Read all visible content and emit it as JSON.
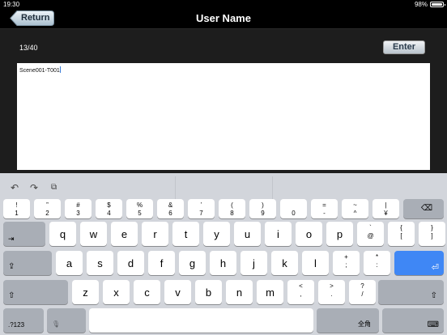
{
  "status": {
    "time": "19:30",
    "battery": "98%",
    "battery_level": 0.98
  },
  "nav": {
    "title": "User Name",
    "return_label": "Return"
  },
  "content": {
    "counter": "13/40",
    "enter_label": "Enter",
    "input_value": "Scene001-T001"
  },
  "keyboard": {
    "toolbar": [
      {
        "icon": "undo-icon"
      },
      {
        "icon": "redo-icon"
      },
      {
        "icon": "paste-icon"
      }
    ],
    "row1": [
      {
        "t": "!",
        "b": "1"
      },
      {
        "t": "”",
        "b": "2"
      },
      {
        "t": "#",
        "b": "3"
      },
      {
        "t": "$",
        "b": "4"
      },
      {
        "t": "%",
        "b": "5"
      },
      {
        "t": "&",
        "b": "6"
      },
      {
        "t": "’",
        "b": "7"
      },
      {
        "t": "(",
        "b": "8"
      },
      {
        "t": ")",
        "b": "9"
      },
      {
        "t": "",
        "b": "0"
      },
      {
        "t": "=",
        "b": "-"
      },
      {
        "t": "~",
        "b": "^"
      },
      {
        "t": "|",
        "b": "¥"
      }
    ],
    "row2": [
      {
        "k": "q"
      },
      {
        "k": "w"
      },
      {
        "k": "e"
      },
      {
        "k": "r"
      },
      {
        "k": "t"
      },
      {
        "k": "y"
      },
      {
        "k": "u"
      },
      {
        "k": "i"
      },
      {
        "k": "o"
      },
      {
        "k": "p"
      },
      {
        "t": "`",
        "b": "@"
      },
      {
        "t": "{",
        "b": "["
      },
      {
        "t": "}",
        "b": "]"
      }
    ],
    "row3": [
      {
        "k": "a"
      },
      {
        "k": "s"
      },
      {
        "k": "d"
      },
      {
        "k": "f"
      },
      {
        "k": "g"
      },
      {
        "k": "h"
      },
      {
        "k": "j"
      },
      {
        "k": "k"
      },
      {
        "k": "l"
      },
      {
        "t": "+",
        "b": ";"
      },
      {
        "t": "*",
        "b": ":"
      }
    ],
    "row4": [
      {
        "k": "z"
      },
      {
        "k": "x"
      },
      {
        "k": "c"
      },
      {
        "k": "v"
      },
      {
        "k": "b"
      },
      {
        "k": "n"
      },
      {
        "k": "m"
      },
      {
        "t": "<",
        "b": ","
      },
      {
        "t": ">",
        "b": "."
      },
      {
        "t": "?",
        "b": "/"
      }
    ],
    "numbers_label": ".?123",
    "kana_label": "全角"
  }
}
